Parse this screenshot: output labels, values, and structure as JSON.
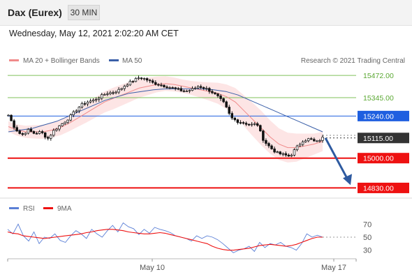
{
  "header": {
    "instrument": "Dax (Eurex)",
    "timeframe": "30 MIN",
    "datetime": "Wednesday, May 12, 2021 2:02:20 AM CET"
  },
  "legend": {
    "ma20_label": "MA 20 + Bollinger Bands",
    "ma50_label": "MA 50",
    "copyright": "Research © 2021 Trading Central",
    "rsi_label": "RSI",
    "rsi_ma_label": "9MA"
  },
  "colors": {
    "ma20": "#f08a8a",
    "ma50": "#3a5fa8",
    "bollinger_fill": "#fde0e0",
    "resistance": "#7fc15a",
    "pivot": "#1f5fe0",
    "support": "#ee1111",
    "current": "#333333",
    "arrow": "#2e5aa0",
    "rsi": "#5a7fd6",
    "rsi_ma": "#ee1111"
  },
  "chart_data": [
    {
      "type": "candlestick",
      "title": "Dax (Eurex)",
      "timeframe": "30 MIN",
      "xlabel": "",
      "ylabel": "",
      "ylim": [
        14780,
        15520
      ],
      "x_ticks": [
        "May 10",
        "May 17"
      ],
      "levels": [
        {
          "label": "15472.00",
          "value": 15472,
          "kind": "resistance"
        },
        {
          "label": "15345.00",
          "value": 15345,
          "kind": "resistance"
        },
        {
          "label": "15240.00",
          "value": 15240,
          "kind": "pivot"
        },
        {
          "label": "15115.00",
          "value": 15115,
          "kind": "current"
        },
        {
          "label": "15000.00",
          "value": 15000,
          "kind": "support"
        },
        {
          "label": "14830.00",
          "value": 14830,
          "kind": "support"
        }
      ],
      "price_path": [
        15245,
        15170,
        15130,
        15160,
        15140,
        15150,
        15110,
        15160,
        15190,
        15220,
        15260,
        15300,
        15320,
        15330,
        15350,
        15370,
        15375,
        15390,
        15420,
        15440,
        15460,
        15450,
        15430,
        15420,
        15410,
        15400,
        15390,
        15380,
        15390,
        15410,
        15400,
        15380,
        15350,
        15310,
        15230,
        15210,
        15200,
        15190,
        15195,
        15100,
        15060,
        15030,
        15020,
        15010,
        15060,
        15100,
        15110,
        15090,
        15115
      ],
      "series": [
        {
          "name": "MA 20 + Bollinger Bands",
          "values": [
            15180,
            15160,
            15150,
            15150,
            15150,
            15160,
            15175,
            15200,
            15230,
            15260,
            15290,
            15320,
            15340,
            15360,
            15380,
            15400,
            15410,
            15420,
            15425,
            15420,
            15410,
            15400,
            15390,
            15380,
            15370,
            15350,
            15320,
            15270,
            15220,
            15170,
            15120,
            15080,
            15060,
            15060,
            15070,
            15080,
            15095
          ]
        },
        {
          "name": "MA 50",
          "values": [
            15150,
            15160,
            15170,
            15190,
            15210,
            15240,
            15270,
            15300,
            15330,
            15350,
            15370,
            15380,
            15390,
            15395,
            15395,
            15395,
            15395,
            15390,
            15380,
            15360,
            15330,
            15300,
            15270,
            15240,
            15210,
            15180,
            15150
          ]
        }
      ],
      "forecast_arrow": {
        "from": 15115,
        "to": 14830
      }
    },
    {
      "type": "line",
      "title": "",
      "ylim": [
        20,
        80
      ],
      "y_ticks": [
        70,
        50,
        30
      ],
      "series": [
        {
          "name": "RSI",
          "values": [
            62,
            55,
            70,
            52,
            44,
            58,
            40,
            50,
            48,
            55,
            45,
            42,
            52,
            60,
            55,
            48,
            62,
            55,
            50,
            60,
            68,
            58,
            72,
            66,
            63,
            54,
            62,
            56,
            65,
            62,
            60,
            57,
            52,
            50,
            48,
            44,
            52,
            48,
            52,
            50,
            46,
            40,
            33,
            26,
            30,
            32,
            36,
            28,
            42,
            34,
            40,
            38,
            42,
            36,
            34,
            30,
            40,
            55,
            50,
            53,
            50
          ]
        },
        {
          "name": "9MA",
          "values": [
            58,
            56,
            55,
            52,
            51,
            50,
            49,
            48,
            49,
            50,
            51,
            52,
            53,
            54,
            55,
            57,
            58,
            60,
            61,
            62,
            62,
            61,
            60,
            58,
            57,
            56,
            55,
            55,
            56,
            57,
            56,
            54,
            52,
            50,
            48,
            46,
            44,
            42,
            40,
            36,
            33,
            31,
            30,
            30,
            31,
            32,
            33,
            35,
            37,
            38,
            39,
            38,
            37,
            36,
            37,
            39,
            42,
            45,
            48,
            50,
            50
          ]
        }
      ]
    }
  ]
}
